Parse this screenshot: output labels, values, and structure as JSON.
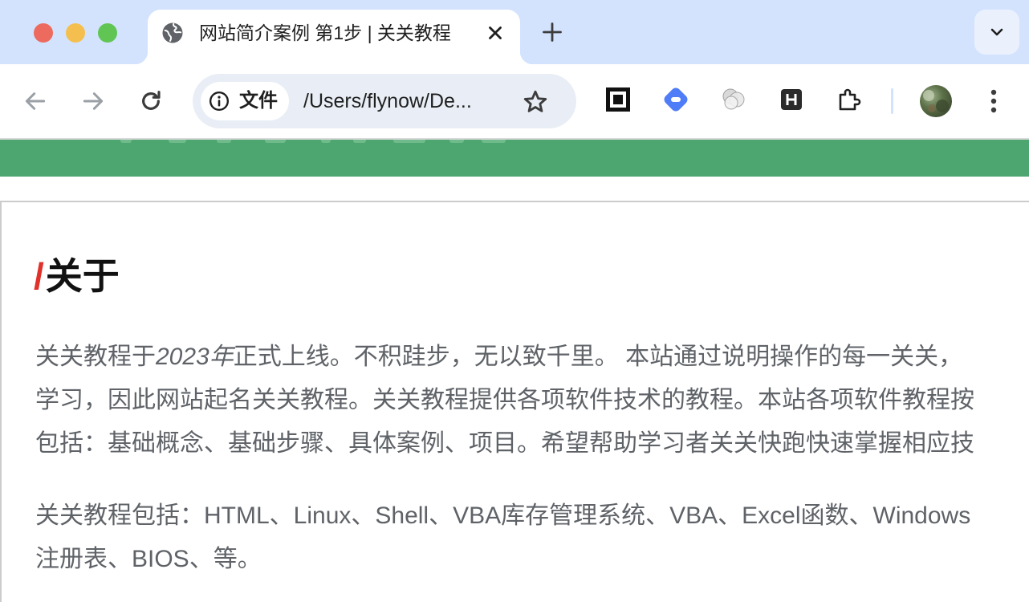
{
  "browser": {
    "tab": {
      "title": "网站简介案例 第1步 | 关关教程",
      "favicon": "globe-icon",
      "close_icon": "close-icon"
    },
    "new_tab_icon": "plus-icon",
    "tab_search_icon": "chevron-down-icon",
    "nav": {
      "back_icon": "arrow-left-icon",
      "forward_icon": "arrow-right-icon",
      "reload_icon": "reload-icon"
    },
    "omnibox": {
      "security_chip_label": "文件",
      "security_icon": "info-icon",
      "url": "/Users/flynow/De...",
      "bookmark_icon": "star-icon"
    },
    "extensions": [
      "qr-code-icon",
      "blue-diamond-icon",
      "gray-circles-icon",
      "h-badge-icon",
      "puzzle-icon"
    ],
    "menu_icon": "more-vertical-icon"
  },
  "colors": {
    "tabstrip": "#d3e3fd",
    "green_band": "#4da670",
    "heading_slash": "#e0312a",
    "body_text": "#5f6368"
  },
  "page": {
    "heading": {
      "slash": "/",
      "text": "关于"
    },
    "paragraph1": {
      "line1_before": "关关教程于",
      "line1_italic": "2023年",
      "line1_after": "正式上线。不积跬步，无以致千里。 本站通过说明操作的每一关关，",
      "line2": "学习，因此网站起名关关教程。关关教程提供各项软件技术的教程。本站各项软件教程按",
      "line3": "包括：基础概念、基础步骤、具体案例、项目。希望帮助学习者关关快跑快速掌握相应技"
    },
    "paragraph2": {
      "line1": "关关教程包括：HTML、Linux、Shell、VBA库存管理系统、VBA、Excel函数、Windows",
      "line2": "注册表、BIOS、等。"
    }
  }
}
